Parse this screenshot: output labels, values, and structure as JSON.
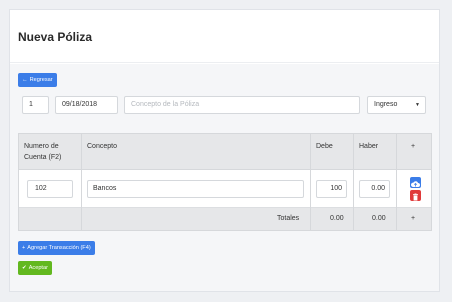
{
  "page": {
    "title": "Nueva Póliza"
  },
  "toolbar": {
    "refresh_icon": "arrow-left-icon",
    "refresh_label": "Regresar"
  },
  "form": {
    "number": "1",
    "date": "09/18/2018",
    "concept_placeholder": "Concepto de la Póliza",
    "type_selected": "Ingreso"
  },
  "table": {
    "headers": {
      "account": "Numero de Cuenta (F2)",
      "concept": "Concepto",
      "debit": "Debe",
      "credit": "Haber",
      "add": "+"
    },
    "rows": [
      {
        "account": "102",
        "concept": "Bancos",
        "debit": "100",
        "credit": "0.00"
      }
    ],
    "footer": {
      "label": "Totales",
      "debit_total": "0.00",
      "credit_total": "0.00",
      "add": "+"
    }
  },
  "actions": {
    "add_transaction_label": "Agregar Transacción (F4)",
    "accept_label": "Aceptar"
  },
  "colors": {
    "primary": "#3b7de8",
    "success": "#62b81f",
    "danger": "#e03a3a"
  }
}
